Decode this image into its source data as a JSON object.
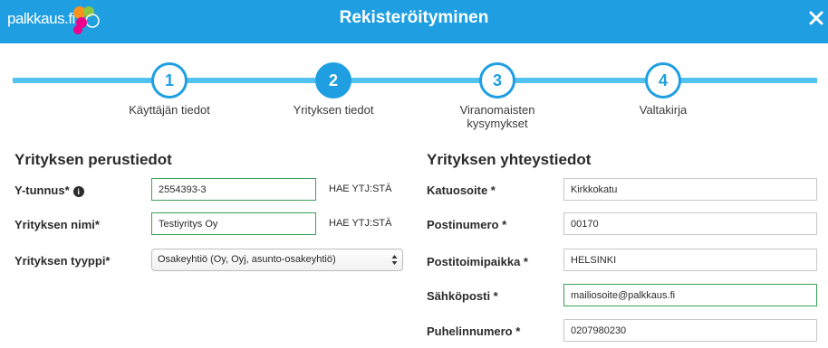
{
  "header": {
    "logo_text": "palkkaus.fi",
    "title": "Rekisteröityminen"
  },
  "steps": [
    {
      "number": "1",
      "label": "Käyttäjän tiedot",
      "active": false
    },
    {
      "number": "2",
      "label": "Yrityksen tiedot",
      "active": true
    },
    {
      "number": "3",
      "label": "Viranomaisten kysymykset",
      "active": false
    },
    {
      "number": "4",
      "label": "Valtakirja",
      "active": false
    }
  ],
  "left": {
    "title": "Yrityksen perustiedot",
    "business_id": {
      "label": "Y-tunnus*",
      "value": "2554393-3",
      "button": "HAE YTJ:STÄ"
    },
    "company_name": {
      "label": "Yrityksen nimi*",
      "value": "Testiyritys Oy",
      "button": "HAE YTJ:STÄ"
    },
    "company_type": {
      "label": "Yrityksen tyyppi*",
      "value": "Osakeyhtiö (Oy, Oyj, asunto-osakeyhtiö)"
    }
  },
  "right": {
    "title": "Yrityksen yhteystiedot",
    "street": {
      "label": "Katuosoite *",
      "value": "Kirkkokatu"
    },
    "postal_code": {
      "label": "Postinumero *",
      "value": "00170"
    },
    "city": {
      "label": "Postitoimipaikka *",
      "value": "HELSINKI"
    },
    "email": {
      "label": "Sähköposti *",
      "value": "mailiosoite@palkkaus.fi"
    },
    "phone": {
      "label": "Puhelinnumero *",
      "value": "0207980230"
    }
  },
  "colors": {
    "header_bg": "#1f9fe2",
    "progress_line": "#52c3ee",
    "valid_border": "#3aa157"
  }
}
